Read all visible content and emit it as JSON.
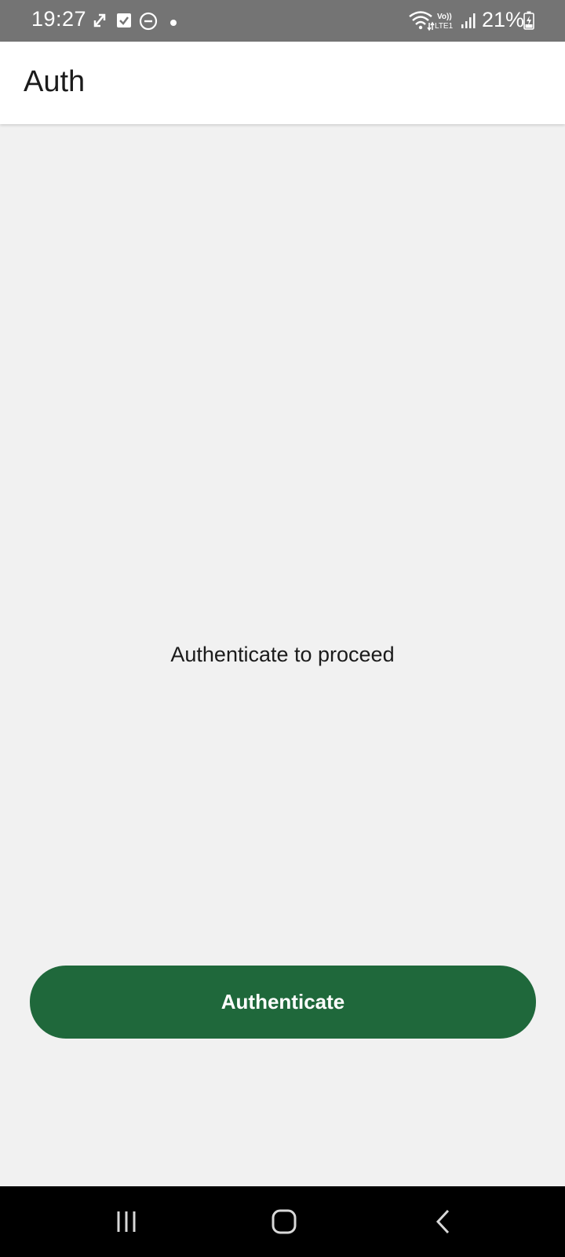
{
  "status_bar": {
    "time": "19:27",
    "battery_percent": "21%",
    "icons": [
      "sync-icon",
      "check-icon",
      "dnd-icon",
      "dot-icon",
      "wifi-icon",
      "volte-lte-icon",
      "signal-icon",
      "battery-charging-icon"
    ]
  },
  "app_bar": {
    "title": "Auth"
  },
  "main": {
    "prompt": "Authenticate to proceed",
    "auth_button_label": "Authenticate"
  },
  "nav_bar": {
    "icons": [
      "recents-icon",
      "home-icon",
      "back-icon"
    ]
  },
  "colors": {
    "status_bar_bg": "#747474",
    "app_bar_bg": "#ffffff",
    "content_bg": "#f1f1f1",
    "accent_button": "#1f683b",
    "nav_bar_bg": "#000000"
  }
}
